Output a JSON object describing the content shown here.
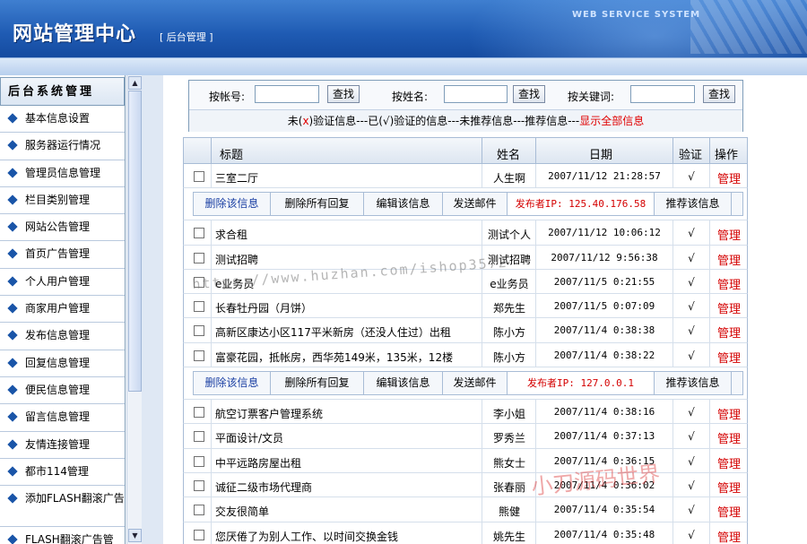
{
  "header": {
    "title": "网站管理中心",
    "subtitle": "[ 后台管理 ]",
    "system_name": "WEB SERVICE SYSTEM"
  },
  "sidebar": {
    "heading": "后台系统管理",
    "items": [
      {
        "label": "基本信息设置"
      },
      {
        "label": "服务器运行情况"
      },
      {
        "label": "管理员信息管理"
      },
      {
        "label": "栏目类别管理"
      },
      {
        "label": "网站公告管理"
      },
      {
        "label": "首页广告管理"
      },
      {
        "label": "个人用户管理"
      },
      {
        "label": "商家用户管理"
      },
      {
        "label": "发布信息管理"
      },
      {
        "label": "回复信息管理"
      },
      {
        "label": "便民信息管理"
      },
      {
        "label": "留言信息管理"
      },
      {
        "label": "友情连接管理"
      },
      {
        "label": "都市114管理"
      },
      {
        "label": "添加FLASH翻滚广告"
      },
      {
        "label": "FLASH翻滚广告管"
      }
    ]
  },
  "search": {
    "account_label": "按帐号:",
    "name_label": "按姓名:",
    "keyword_label": "按关键词:",
    "account_value": "",
    "name_value": "",
    "keyword_value": "",
    "button_label": "查找",
    "filter": {
      "unverified_pre": "未(",
      "unverified_mark": "x",
      "unverified_post": ")验证信息---已(",
      "verified_mark": "√",
      "verified_post": ")验证的信息---未推荐信息---推荐信息---",
      "show_all": "显示全部信息"
    }
  },
  "table": {
    "headers": {
      "title": "标题",
      "name": "姓名",
      "date": "日期",
      "verify": "验证",
      "action": "操作"
    },
    "rows_top": [
      {
        "title": "三室二厅",
        "name": "人生啊",
        "date": "2007/11/12 21:28:57",
        "verify": "√",
        "action": "管理"
      }
    ],
    "actions1": {
      "delete": "删除该信息",
      "delete_replies": "删除所有回复",
      "edit": "编辑该信息",
      "email": "发送邮件",
      "ip": "发布者IP: 125.40.176.58",
      "recommend": "推荐该信息"
    },
    "rows_mid": [
      {
        "title": "求合租",
        "name": "测试个人",
        "date": "2007/11/12 10:06:12",
        "verify": "√",
        "action": "管理"
      },
      {
        "title": "测试招聘",
        "name": "测试招聘",
        "date": "2007/11/12 9:56:38",
        "verify": "√",
        "action": "管理"
      },
      {
        "title": "e业务员",
        "name": "e业务员",
        "date": "2007/11/5 0:21:55",
        "verify": "√",
        "action": "管理"
      },
      {
        "title": "长春牡丹园（月饼）",
        "name": "郑先生",
        "date": "2007/11/5 0:07:09",
        "verify": "√",
        "action": "管理"
      },
      {
        "title": "高新区康达小区117平米新房（还没人住过）出租",
        "name": "陈小方",
        "date": "2007/11/4 0:38:38",
        "verify": "√",
        "action": "管理"
      },
      {
        "title": "富豪花园，抵帐房，西华苑149米，135米，12楼",
        "name": "陈小方",
        "date": "2007/11/4 0:38:22",
        "verify": "√",
        "action": "管理"
      }
    ],
    "actions2": {
      "delete": "删除该信息",
      "delete_replies": "删除所有回复",
      "edit": "编辑该信息",
      "email": "发送邮件",
      "ip": "发布者IP: 127.0.0.1",
      "recommend": "推荐该信息"
    },
    "rows_bottom": [
      {
        "title": "航空订票客户管理系统",
        "name": "李小姐",
        "date": "2007/11/4 0:38:16",
        "verify": "√",
        "action": "管理"
      },
      {
        "title": "平面设计/文员",
        "name": "罗秀兰",
        "date": "2007/11/4 0:37:13",
        "verify": "√",
        "action": "管理"
      },
      {
        "title": "中平远路房屋出租",
        "name": "熊女士",
        "date": "2007/11/4 0:36:15",
        "verify": "√",
        "action": "管理"
      },
      {
        "title": "诚征二级市场代理商",
        "name": "张春丽",
        "date": "2007/11/4 0:36:02",
        "verify": "√",
        "action": "管理"
      },
      {
        "title": "交友很简单",
        "name": "熊健",
        "date": "2007/11/4 0:35:54",
        "verify": "√",
        "action": "管理"
      },
      {
        "title": "您厌倦了为别人工作、以时间交换金钱",
        "name": "姚先生",
        "date": "2007/11/4 0:35:48",
        "verify": "√",
        "action": "管理"
      }
    ]
  },
  "overlays": {
    "watermark": "https://www.huzhan.com/ishop3572",
    "seal": "小刀源码世界"
  },
  "colors": {
    "header_blue": "#1f5bb3",
    "accent_red": "#d40000",
    "link_blue": "#1a3fa3"
  }
}
